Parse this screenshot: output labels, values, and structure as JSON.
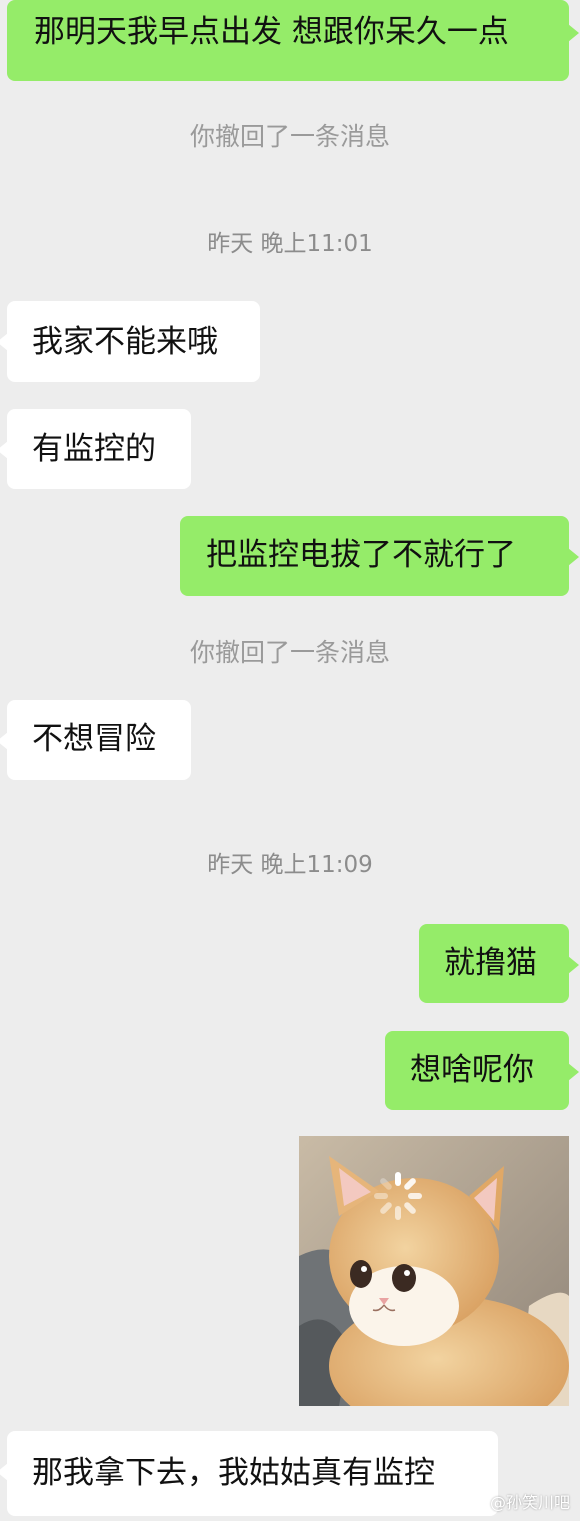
{
  "chat": {
    "messages": [
      {
        "side": "right",
        "text": "那明天我早点出发 想跟你呆久一点"
      },
      {
        "type": "system",
        "text": "你撤回了一条消息"
      },
      {
        "type": "time",
        "text": "昨天 晚上11:01"
      },
      {
        "side": "left",
        "text": "我家不能来哦"
      },
      {
        "side": "left",
        "text": "有监控的"
      },
      {
        "side": "right",
        "text": "把监控电拔了不就行了"
      },
      {
        "type": "system",
        "text": "你撤回了一条消息"
      },
      {
        "side": "left",
        "text": "不想冒险"
      },
      {
        "type": "time",
        "text": "昨天 晚上11:09"
      },
      {
        "side": "right",
        "text": "就撸猫"
      },
      {
        "side": "right",
        "text": "想啥呢你"
      },
      {
        "side": "left",
        "type": "sticker",
        "icon": "loading-cat-sticker"
      },
      {
        "side": "left",
        "text": "那我拿下去，我姑姑真有监控"
      }
    ]
  },
  "watermark": "@孙笑川吧",
  "colors": {
    "background": "#ededed",
    "outgoing_bubble": "#95ec69",
    "incoming_bubble": "#ffffff",
    "system_text": "#9a9a9a"
  }
}
